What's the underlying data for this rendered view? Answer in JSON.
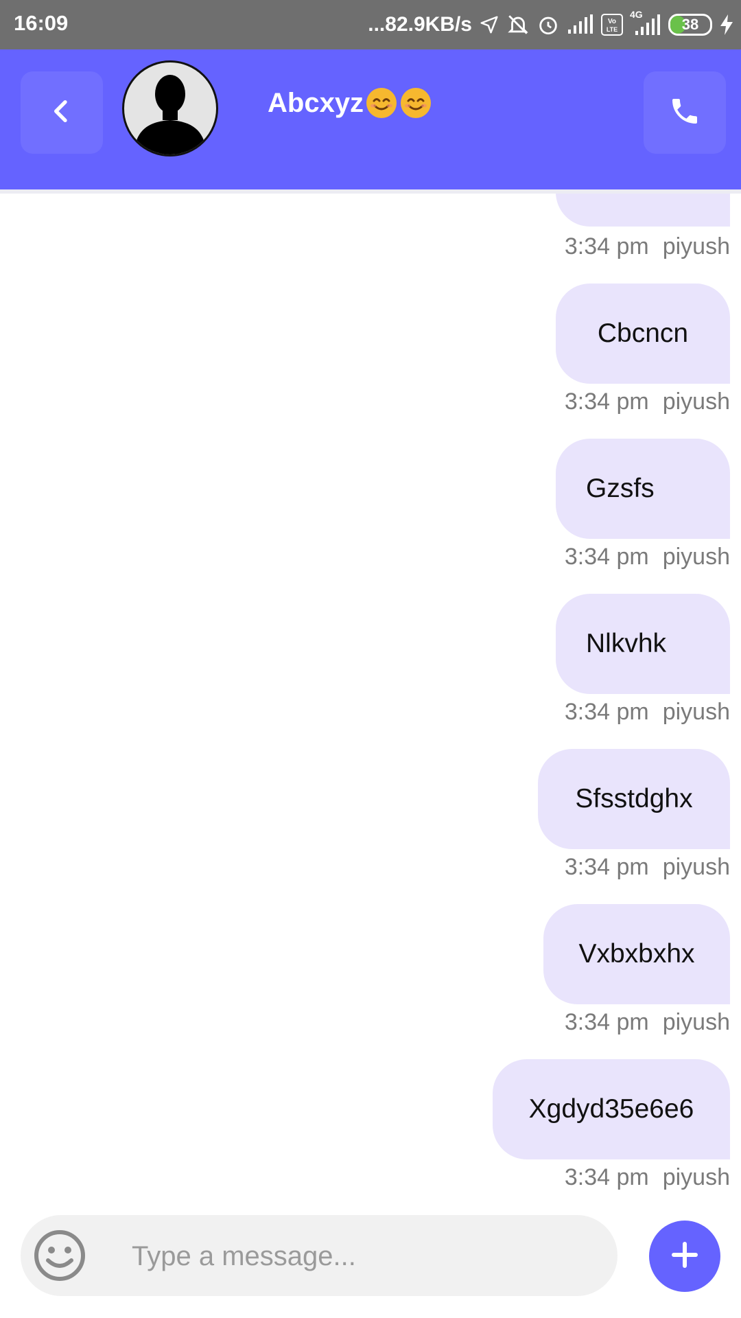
{
  "status_bar": {
    "time": "16:09",
    "network_speed": "...82.9KB/s",
    "network_type": "4G",
    "battery_level": "38",
    "icons": [
      "location-arrow-icon",
      "mute-bell-icon",
      "alarm-icon",
      "signal-icon",
      "volte-icon",
      "signal-4g-icon",
      "battery-icon",
      "charging-icon"
    ]
  },
  "header": {
    "back_icon": "chevron-left-icon",
    "contact_name": "Abcxyz",
    "contact_emojis": [
      "smiling-face",
      "smiling-face"
    ],
    "call_icon": "phone-icon",
    "accent_color": "#6563ff"
  },
  "messages": [
    {
      "text": "",
      "time": "3:34 pm",
      "sender": "piyush"
    },
    {
      "text": "Cbcncn",
      "time": "3:34 pm",
      "sender": "piyush"
    },
    {
      "text": "Gzsfs",
      "time": "3:34 pm",
      "sender": "piyush"
    },
    {
      "text": "Nlkvhk",
      "time": "3:34 pm",
      "sender": "piyush"
    },
    {
      "text": "Sfsstdghx",
      "time": "3:34 pm",
      "sender": "piyush"
    },
    {
      "text": "Vxbxbxhx",
      "time": "3:34 pm",
      "sender": "piyush"
    },
    {
      "text": "Xgdyd35e6e6",
      "time": "3:34 pm",
      "sender": "piyush"
    }
  ],
  "composer": {
    "placeholder": "Type a message...",
    "value": "",
    "emoji_icon": "smiley-icon",
    "add_icon": "plus-icon"
  },
  "colors": {
    "bubble": "#e9e4fc",
    "meta_text": "#7a7a7a",
    "status_bar": "#6f6f6f"
  }
}
